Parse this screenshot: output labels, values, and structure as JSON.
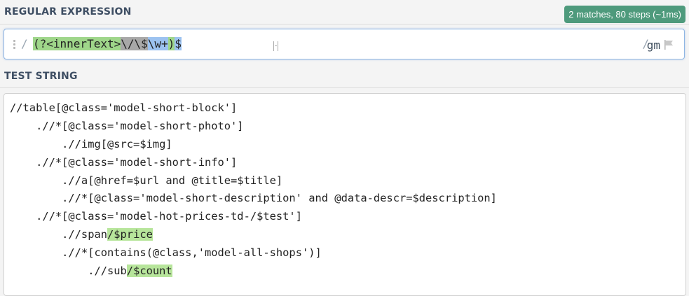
{
  "regex_section": {
    "title": "REGULAR EXPRESSION",
    "match_info": "2 matches, 80 steps (~1ms)",
    "delimiter_open": "/",
    "delimiter_close": "/",
    "flags": "gm",
    "tokens": [
      {
        "text": "(?<innerText>",
        "kind": "group"
      },
      {
        "text": "\\/\\$",
        "kind": "escape"
      },
      {
        "text": "\\w+",
        "kind": "class"
      },
      {
        "text": ")",
        "kind": "group"
      },
      {
        "text": "$",
        "kind": "class"
      }
    ]
  },
  "test_section": {
    "title": "TEST STRING",
    "lines": [
      [
        {
          "text": "//table[@class='model-short-block']"
        }
      ],
      [
        {
          "text": "    .//*[@class='model-short-photo']"
        }
      ],
      [
        {
          "text": "        .//img[@src=$img]"
        }
      ],
      [
        {
          "text": "    .//*[@class='model-short-info']"
        }
      ],
      [
        {
          "text": "        .//a[@href=$url and @title=$title]"
        }
      ],
      [
        {
          "text": "        .//*[@class='model-short-description' and @data-descr=$description]"
        }
      ],
      [
        {
          "text": "    .//*[@class='model-hot-prices-td-/$test']"
        }
      ],
      [
        {
          "text": "        .//span"
        },
        {
          "text": "/$price",
          "match": true
        }
      ],
      [
        {
          "text": "        .//*[contains(@class,'model-all-shops')]"
        }
      ],
      [
        {
          "text": "            .//sub"
        },
        {
          "text": "/$count",
          "match": true
        }
      ]
    ]
  },
  "colors": {
    "badge": "#4e9a7c",
    "group_highlight": "#9fd68a",
    "escape_highlight": "#a8a8a8",
    "class_highlight": "#9cc2f0",
    "match_highlight": "#b7e59b"
  },
  "icons": {
    "drag": "drag-handle-icon",
    "flag": "flag-icon"
  }
}
